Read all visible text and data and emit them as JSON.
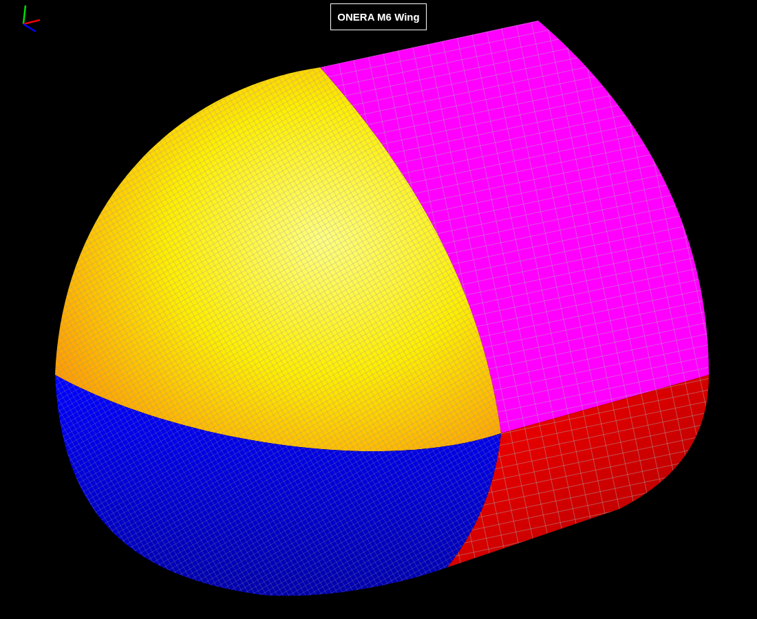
{
  "title": "ONERA M6 Wing"
}
